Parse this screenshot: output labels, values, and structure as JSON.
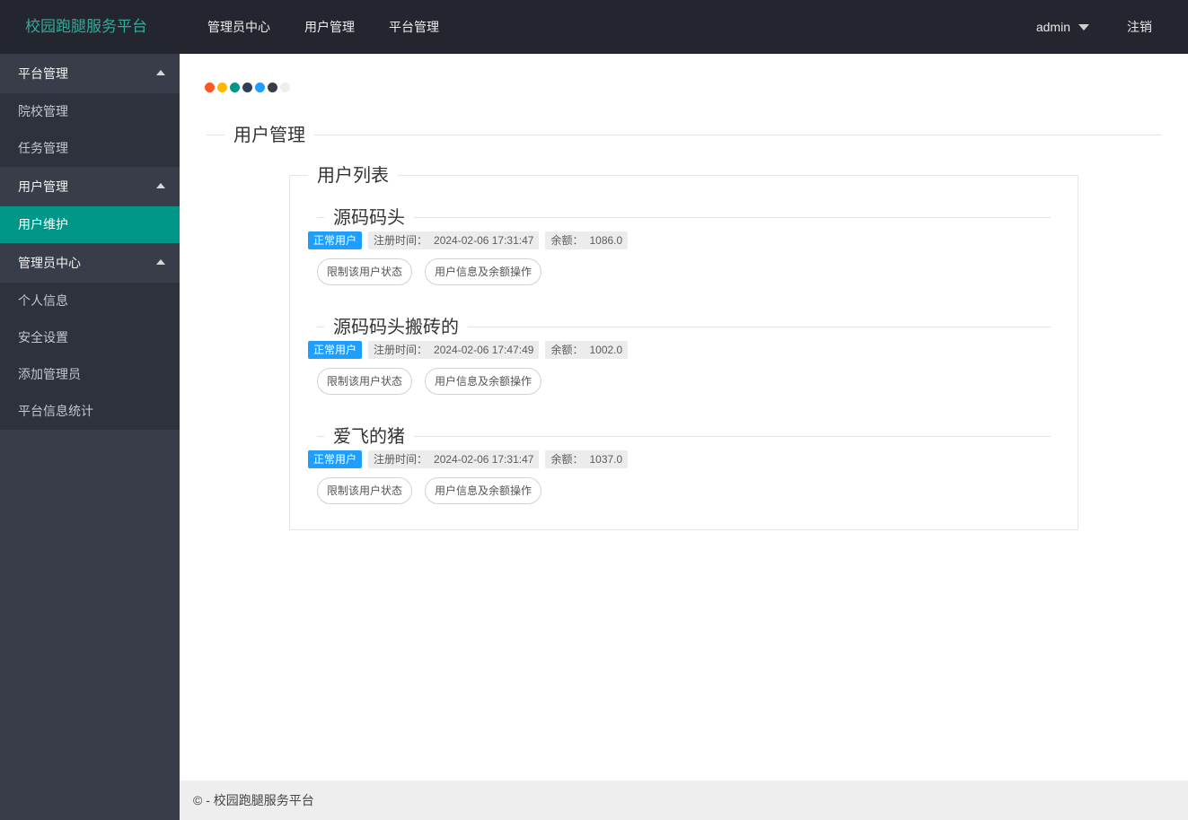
{
  "navbar": {
    "brand": "校园跑腿服务平台",
    "items": [
      {
        "id": "admin-center",
        "label": "管理员中心"
      },
      {
        "id": "user-mgmt",
        "label": "用户管理"
      },
      {
        "id": "platform-mgmt",
        "label": "平台管理"
      }
    ],
    "user": "admin",
    "logout_label": "注销"
  },
  "sidebar": {
    "sections": [
      {
        "id": "platform-mgmt",
        "label": "平台管理",
        "items": [
          {
            "id": "school-mgmt",
            "label": "院校管理",
            "active": false
          },
          {
            "id": "task-mgmt",
            "label": "任务管理",
            "active": false
          }
        ]
      },
      {
        "id": "user-mgmt",
        "label": "用户管理",
        "items": [
          {
            "id": "user-maintenance",
            "label": "用户维护",
            "active": true
          }
        ]
      },
      {
        "id": "admin-center",
        "label": "管理员中心",
        "items": [
          {
            "id": "personal-info",
            "label": "个人信息",
            "active": false
          },
          {
            "id": "security-settings",
            "label": "安全设置",
            "active": false
          },
          {
            "id": "add-admin",
            "label": "添加管理员",
            "active": false
          },
          {
            "id": "platform-stats",
            "label": "平台信息统计",
            "active": false
          }
        ]
      }
    ]
  },
  "palette_dots": [
    "#FF5722",
    "#FFB800",
    "#009688",
    "#2F4056",
    "#1E9FFF",
    "#393D49",
    "#EEEEEE"
  ],
  "page": {
    "title": "用户管理"
  },
  "panel": {
    "title": "用户列表"
  },
  "users": [
    {
      "name": "源码码头",
      "status": "正常用户",
      "reg_label": "注册时间：",
      "reg_time": "2024-02-06 17:31:47",
      "balance_label": "余额：",
      "balance": "1086.0"
    },
    {
      "name": "源码码头搬砖的",
      "status": "正常用户",
      "reg_label": "注册时间：",
      "reg_time": "2024-02-06 17:47:49",
      "balance_label": "余额：",
      "balance": "1002.0"
    },
    {
      "name": "爱飞的猪",
      "status": "正常用户",
      "reg_label": "注册时间：",
      "reg_time": "2024-02-06 17:31:47",
      "balance_label": "余额：",
      "balance": "1037.0"
    }
  ],
  "user_actions": {
    "restrict": "限制该用户状态",
    "info": "用户信息及余额操作"
  },
  "footer": {
    "copyright": "© - 校园跑腿服务平台"
  },
  "colors": {
    "accent": "#009688",
    "badge_blue": "#1E9FFF",
    "navbar_bg": "#23262E",
    "sidebar_bg": "#393D49",
    "brand_text": "#33A99A"
  }
}
